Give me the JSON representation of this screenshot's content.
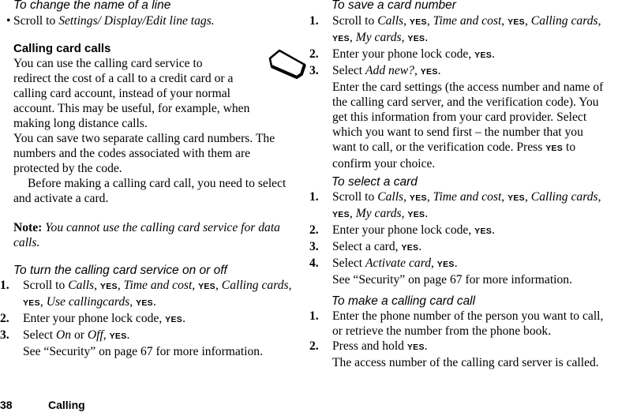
{
  "page": {
    "number": "38",
    "chapter": "Calling"
  },
  "left": {
    "change_line": {
      "heading": "To change the name of a line",
      "bullet": "•",
      "text_prefix": "Scroll to ",
      "path": "Settings/ Display/Edit line tags."
    },
    "calling_card": {
      "heading": "Calling card calls",
      "para1_lines": [
        "You can use the calling card service to",
        "redirect the cost of a call to a credit card or a",
        "calling card account, instead of your normal",
        "account. This may be useful, for example, when",
        "making long distance calls."
      ],
      "para2_lines": [
        "You can save two separate calling card numbers. The",
        "numbers and the codes associated with them are",
        "protected by the code."
      ],
      "para3_lines": [
        "Before making a calling card call, you need to select",
        "and activate a card."
      ],
      "note_label": "Note:",
      "note_lines": [
        "You cannot use the calling card service for data",
        "calls."
      ],
      "icon": "calling-card-icon"
    },
    "turn_on_off": {
      "heading": "To turn the calling card service on or off",
      "steps": [
        {
          "num": "1.",
          "parts": [
            "Scroll to ",
            "Calls",
            ", ",
            "YES",
            ", ",
            "Time and cost",
            ", ",
            "YES",
            ", ",
            "Calling cards",
            ","
          ],
          "line2": [
            "YES",
            ", ",
            "Use callingcards",
            ", ",
            "YES",
            "."
          ]
        },
        {
          "num": "2.",
          "text": "Enter your phone lock code, ",
          "yes": "YES",
          "end": "."
        },
        {
          "num": "3.",
          "text": "Select ",
          "opt1": "On",
          "or": " or ",
          "opt2": "Off",
          "sep": ", ",
          "yes": "YES",
          "end": ".",
          "note": "See “Security” on page 67 for more information."
        }
      ]
    }
  },
  "right": {
    "save_card": {
      "heading": "To save a card number",
      "step1": {
        "num": "1.",
        "scroll": "Scroll to ",
        "calls": "Calls",
        "yes": "YES",
        "time": "Time and cost",
        "cards": "Calling cards",
        "my": "My cards"
      },
      "step2": {
        "num": "2.",
        "text": "Enter your phone lock code, ",
        "yes": "YES"
      },
      "step3": {
        "num": "3.",
        "text": "Select ",
        "option": "Add new?",
        "yes": "YES"
      },
      "description_lines": [
        "Enter the card settings (the access number and name of",
        "the calling card server, and the verification code). You",
        "get this information from your card provider. Select",
        "which you want to send first – the number that you"
      ],
      "description_last_prefix": "want to call, or the verification code. Press ",
      "description_last_yes": "YES",
      "description_last_suffix": " to",
      "description_end": "confirm your choice."
    },
    "select_card": {
      "heading": "To select a card",
      "step1": {
        "num": "1.",
        "scroll": "Scroll to ",
        "calls": "Calls",
        "yes": "YES",
        "time": "Time and cost",
        "cards": "Calling cards",
        "my": "My cards"
      },
      "step2": {
        "num": "2.",
        "text": "Enter your phone lock code, ",
        "yes": "YES"
      },
      "step3": {
        "num": "3.",
        "text": "Select a card, ",
        "yes": "YES"
      },
      "step4": {
        "num": "4.",
        "text": "Select ",
        "option": "Activate card",
        "yes": "YES"
      },
      "note": "See “Security” on page 67 for more information."
    },
    "make_call": {
      "heading": "To make a calling card call",
      "step1": {
        "num": "1.",
        "line1": "Enter the phone number of the person you want to call,",
        "line2": "or retrieve the number from the phone book."
      },
      "step2": {
        "num": "2.",
        "text": "Press and hold ",
        "yes": "YES",
        "result": "The access number of the calling card server is called."
      }
    }
  }
}
